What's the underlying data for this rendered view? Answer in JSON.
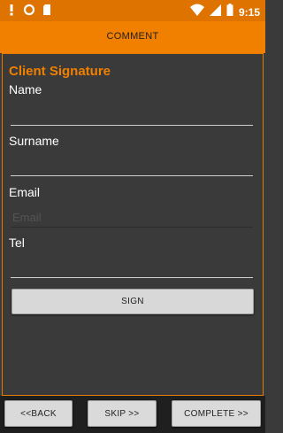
{
  "status_bar": {
    "time": "9:15",
    "icons": [
      "alert-icon",
      "sync-icon",
      "sd-card-icon",
      "wifi-icon",
      "signal-icon",
      "battery-icon"
    ]
  },
  "app_bar": {
    "title": "COMMENT"
  },
  "form": {
    "section_title": "Client Signature",
    "name_label": "Name",
    "name_value": "",
    "surname_label": "Surname",
    "surname_value": "",
    "email_label": "Email",
    "email_value": "",
    "email_placeholder": "Email",
    "tel_label": "Tel",
    "tel_value": "",
    "sign_label": "SIGN"
  },
  "nav": {
    "back_label": "<<BACK",
    "skip_label": "SKIP >>",
    "complete_label": "COMPLETE >>"
  },
  "colors": {
    "accent": "#f28000",
    "status_bar": "#de7300",
    "background": "#3a3a3a",
    "button": "#d8d8d8"
  }
}
